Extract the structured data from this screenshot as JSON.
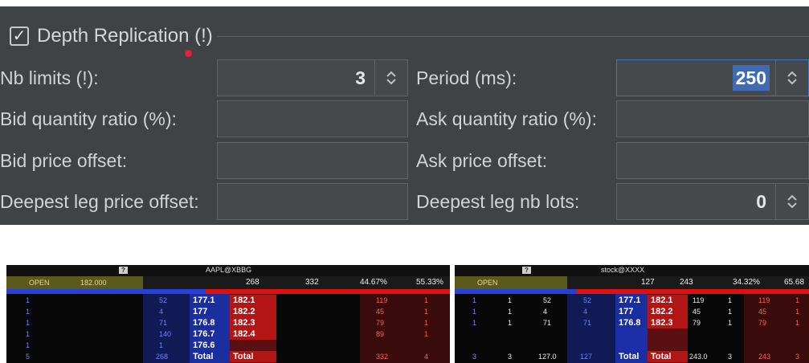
{
  "settings": {
    "group_title": "Depth Replication (!)",
    "group_checked": "✓",
    "nb_limits_label": "Nb limits (!):",
    "nb_limits_value": "3",
    "period_label": "Period (ms):",
    "period_value": "250",
    "bid_qty_label": "Bid quantity ratio (%):",
    "bid_qty_value": "",
    "ask_qty_label": "Ask quantity ratio (%):",
    "ask_qty_value": "",
    "bid_price_label": "Bid price offset:",
    "bid_price_value": "",
    "ask_price_label": "Ask price offset:",
    "ask_price_value": "",
    "deepest_price_label": "Deepest leg price offset:",
    "deepest_price_value": "",
    "deepest_lots_label": "Deepest leg nb lots:",
    "deepest_lots_value": "0"
  },
  "ladder_left": {
    "qmark": "?",
    "symbol": "AAPL@XBBG",
    "open": "OPEN",
    "open_value": "182.000",
    "stats": [
      "268",
      "332",
      "44.67%",
      "55.33%"
    ],
    "rows": [
      {
        "bq_l": "1",
        "bq": "52",
        "bid": "177.1",
        "ask": "182.1",
        "aq": "119",
        "an": "1"
      },
      {
        "bq_l": "1",
        "bq": "4",
        "bid": "177",
        "ask": "182.2",
        "aq": "45",
        "an": "1"
      },
      {
        "bq_l": "1",
        "bq": "71",
        "bid": "176.8",
        "ask": "182.3",
        "aq": "79",
        "an": "1"
      },
      {
        "bq_l": "1",
        "bq": "140",
        "bid": "176.7",
        "ask": "182.4",
        "aq": "89",
        "an": "1"
      },
      {
        "bq_l": "1",
        "bq": "1",
        "bid": "176.6",
        "ask": "",
        "aq": "",
        "an": ""
      }
    ],
    "total": {
      "bq_l": "5",
      "bq": "268",
      "bid": "Total",
      "ask": "Total",
      "aq": "332",
      "an": "4"
    }
  },
  "ladder_right": {
    "qmark": "?",
    "symbol": "stock@XXXX",
    "open": "OPEN",
    "stats": [
      "127",
      "243",
      "34.32%",
      "65.68"
    ],
    "rows": [
      {
        "c1": "1",
        "c2": "1",
        "c3": "52",
        "bq": "52",
        "bid": "177.1",
        "ask": "182.1",
        "a1": "119",
        "a2": "1",
        "aq": "119",
        "an": "1"
      },
      {
        "c1": "1",
        "c2": "1",
        "c3": "4",
        "bq": "4",
        "bid": "177",
        "ask": "182.2",
        "a1": "45",
        "a2": "1",
        "aq": "45",
        "an": "1"
      },
      {
        "c1": "1",
        "c2": "1",
        "c3": "71",
        "bq": "71",
        "bid": "176.8",
        "ask": "182.3",
        "a1": "79",
        "a2": "1",
        "aq": "79",
        "an": "1"
      }
    ],
    "total": {
      "c1": "3",
      "c2": "3",
      "c3": "127.0",
      "bq": "127",
      "bid": "Total",
      "ask": "Total",
      "a1": "243.0",
      "a2": "3",
      "aq": "243",
      "an": "3"
    }
  }
}
